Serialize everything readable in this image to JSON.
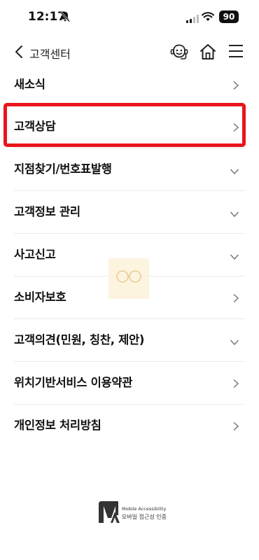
{
  "status_bar": {
    "time": "12:17",
    "battery": "90"
  },
  "header": {
    "title": "고객센터"
  },
  "menu_items": [
    {
      "label": "새소식",
      "chevron": "right"
    },
    {
      "label": "고객상담",
      "chevron": "right",
      "highlighted": true
    },
    {
      "label": "지점찾기/번호표발행",
      "chevron": "down"
    },
    {
      "label": "고객정보 관리",
      "chevron": "down"
    },
    {
      "label": "사고신고",
      "chevron": "down"
    },
    {
      "label": "소비자보호",
      "chevron": "right"
    },
    {
      "label": "고객의견(민원, 칭찬, 제안)",
      "chevron": "down"
    },
    {
      "label": "위치기반서비스 이용약관",
      "chevron": "right"
    },
    {
      "label": "개인정보 처리방침",
      "chevron": "right"
    }
  ],
  "footer": {
    "logo_mark": "MA",
    "logo_en": "Mobile Accessibility",
    "logo_ko": "모바일 접근성 인증"
  },
  "colors": {
    "highlight": "#e8151b",
    "divider": "#e9e9e9",
    "watermark": "#fdf3dc"
  }
}
